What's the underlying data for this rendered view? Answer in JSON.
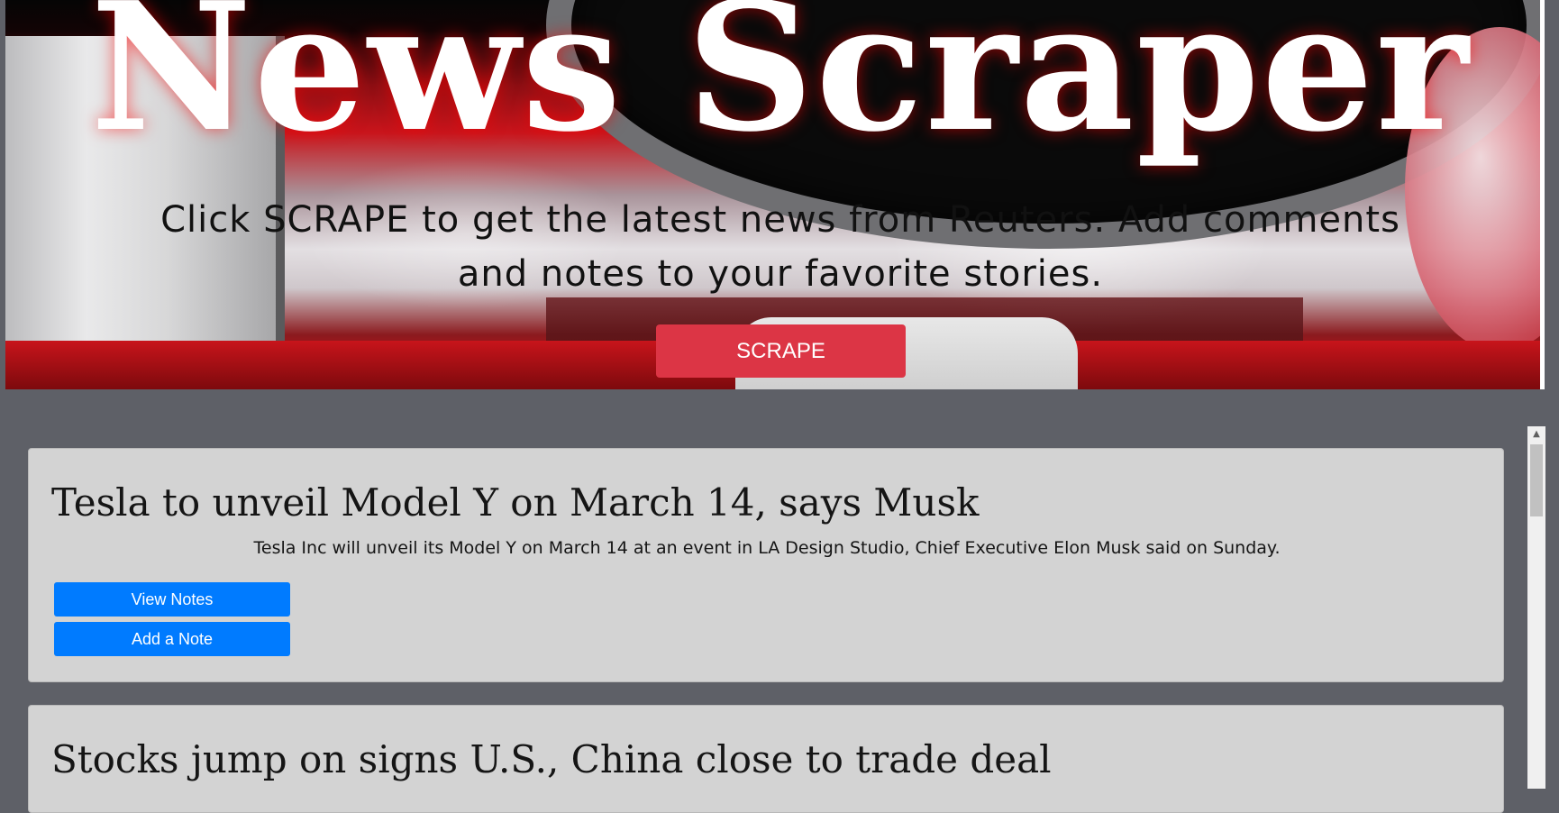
{
  "hero": {
    "title": "News Scraper",
    "subtitle": "Click SCRAPE to get the latest news from Reuters. Add comments and notes to your favorite stories.",
    "scrape_label": "SCRAPE"
  },
  "articles": [
    {
      "headline": "Tesla to unveil Model Y on March 14, says Musk",
      "summary": "Tesla Inc will unveil its Model Y on March 14 at an event in LA Design Studio, Chief Executive Elon Musk said on Sunday.",
      "view_notes_label": "View Notes",
      "add_note_label": "Add a Note"
    },
    {
      "headline": "Stocks jump on signs U.S., China close to trade deal"
    }
  ],
  "colors": {
    "scrape_button": "#dc3545",
    "note_button": "#007bff",
    "card_background": "#d3d3d3",
    "page_background": "#5e6067"
  },
  "icons": {
    "scroll_up": "chevron-up-icon"
  }
}
